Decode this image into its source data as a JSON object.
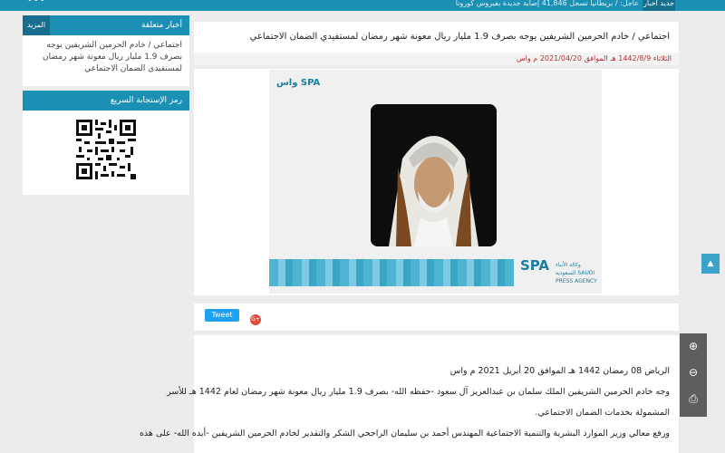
{
  "ticker": {
    "label": "جديد أخبار",
    "text": "عاجل: / بريطانيا تسجل 41,846 إصابة جديدة بفيروس كورونا",
    "dots": "•••"
  },
  "sidebar": {
    "related": {
      "title": "أخبار متعلقة",
      "more_label": "المزيد",
      "items": [
        "اجتماعي / خادم الحرمين الشريفين يوجه بصرف 1.9 مليار ريال معونة شهر رمضان لمستفيدي الضمان الاجتماعي"
      ]
    },
    "qr": {
      "title": "رمز الإستجابة السريع"
    }
  },
  "article": {
    "title": "اجتماعي / خادم الحرمين الشريفين يوجه بصرف 1.9 مليار ريال معونة شهر رمضان لمستفيدي الضمان الاجتماعي",
    "date": "الثلاثاء 1442/8/9 هـ الموافق 2021/04/20 م واس",
    "image_logo": {
      "spa_small": "واس SPA",
      "agency_text": "وكالة الأنباء السعودية SAUDI PRESS AGENCY"
    },
    "share": {
      "tweet_label": "Tweet",
      "gplus_label": "G+"
    },
    "body": [
      "الرياض 08 رمضان 1442 هـ الموافق 20 أبريل 2021 م واس",
      "وجه خادم الحرمين الشريفين الملك سلمان بن عبدالعزيز آل سعود -حفظه الله- بصرف 1.9 مليار ريال معونة شهر رمضان لعام 1442 هـ للأسر",
      "المشمولة بخدمات الضمان الاجتماعي.",
      "ورفع معالي وزير الموارد البشرية والتنمية الاجتماعية المهندس أحمد بن سليمان الراجحي الشكر والتقدير لخادم الحرمين الشريفين -أيده الله- على هذه"
    ]
  },
  "controls": {
    "scroll_top_icon": "chevron-up-icon",
    "zoom_in_icon": "zoom-in-icon",
    "zoom_out_icon": "zoom-out-icon",
    "print_icon": "printer-icon"
  }
}
